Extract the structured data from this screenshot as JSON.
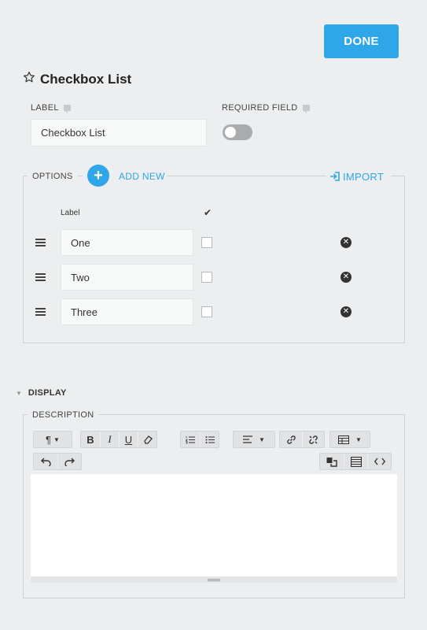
{
  "header": {
    "done_label": "DONE"
  },
  "field": {
    "title": "Checkbox List",
    "label_heading": "LABEL",
    "label_value": "Checkbox List",
    "required_heading": "REQUIRED FIELD",
    "required_on": false
  },
  "options": {
    "heading": "OPTIONS",
    "add_new_label": "ADD NEW",
    "import_label": "IMPORT",
    "column_label": "Label",
    "column_check": "✔",
    "items": [
      {
        "label": "One",
        "checked": false
      },
      {
        "label": "Two",
        "checked": false
      },
      {
        "label": "Three",
        "checked": false
      }
    ]
  },
  "display": {
    "heading": "DISPLAY",
    "description_heading": "DESCRIPTION",
    "toolbar": {
      "paragraph": "¶",
      "bold": "B",
      "italic": "I",
      "underline": "U",
      "eraser": "⌫",
      "ordered_list": "⋮",
      "bullet_list": "☰",
      "align": "≡",
      "link": "🔗",
      "unlink": "⛓",
      "table": "▦",
      "undo": "↶",
      "redo": "↷",
      "code": "<>"
    }
  },
  "colors": {
    "accent": "#2ea6e8",
    "background": "#eceeef"
  }
}
